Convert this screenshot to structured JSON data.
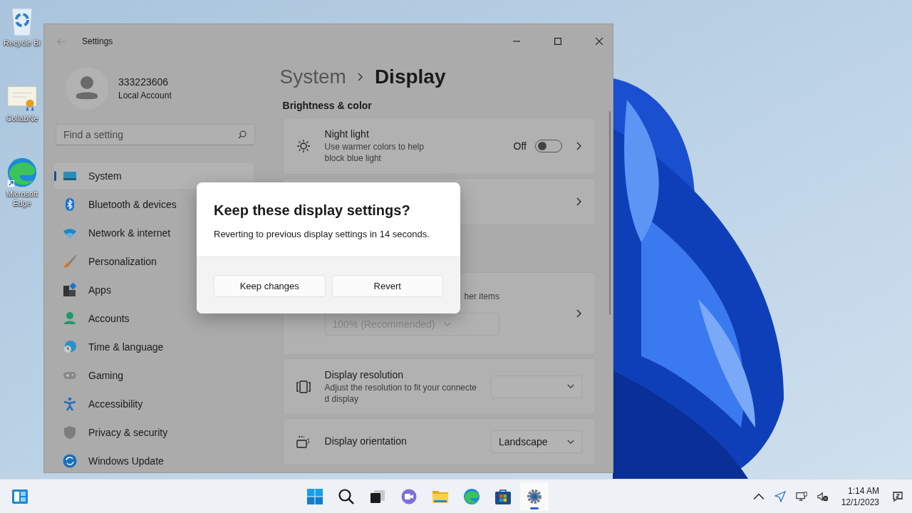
{
  "desktop_icons": [
    {
      "kind": "recycle",
      "label": "Recycle Bi"
    },
    {
      "kind": "certificate",
      "label": "CollabNe"
    },
    {
      "kind": "edge",
      "label": "Microsoft Edge"
    }
  ],
  "window": {
    "title": "Settings"
  },
  "account": {
    "name": "333223606",
    "type": "Local Account"
  },
  "search": {
    "placeholder": "Find a setting"
  },
  "nav": [
    {
      "kind": "system",
      "label": "System",
      "selected": true
    },
    {
      "kind": "bluetooth",
      "label": "Bluetooth & devices",
      "selected": false
    },
    {
      "kind": "network",
      "label": "Network & internet",
      "selected": false
    },
    {
      "kind": "personalization",
      "label": "Personalization",
      "selected": false
    },
    {
      "kind": "apps",
      "label": "Apps",
      "selected": false
    },
    {
      "kind": "accounts",
      "label": "Accounts",
      "selected": false
    },
    {
      "kind": "time",
      "label": "Time & language",
      "selected": false
    },
    {
      "kind": "gaming",
      "label": "Gaming",
      "selected": false
    },
    {
      "kind": "accessibility",
      "label": "Accessibility",
      "selected": false
    },
    {
      "kind": "privacy",
      "label": "Privacy & security",
      "selected": false
    },
    {
      "kind": "update",
      "label": "Windows Update",
      "selected": false
    }
  ],
  "breadcrumb": {
    "parent": "System",
    "current": "Display"
  },
  "section": "Brightness & color",
  "cards": [
    {
      "kind": "toggle",
      "title": "Night light",
      "description_lines": [
        "Use warmer colors to help",
        "block blue light"
      ],
      "state_label": "Off",
      "on": false
    },
    {
      "kind": "link"
    },
    {
      "kind": "scale",
      "description_fragment": "her items",
      "dropdown": "100% (Recommended)",
      "disabled": true
    },
    {
      "kind": "dropdown",
      "title": "Display resolution",
      "description_lines": [
        "Adjust the resolution to fit your connecte",
        "d display"
      ]
    },
    {
      "kind": "dropdown",
      "title": "Display orientation",
      "value": "Landscape"
    }
  ],
  "dialog": {
    "title": "Keep these display settings?",
    "message": "Reverting to previous display settings in 14 seconds.",
    "buttons": [
      "Keep changes",
      "Revert"
    ]
  },
  "taskbar": {
    "apps": [
      {
        "kind": "start",
        "active": false
      },
      {
        "kind": "search",
        "active": false
      },
      {
        "kind": "taskview",
        "active": false
      },
      {
        "kind": "chat",
        "active": false
      },
      {
        "kind": "explorer",
        "active": false
      },
      {
        "kind": "edge",
        "active": false
      },
      {
        "kind": "store",
        "active": false
      },
      {
        "kind": "settings",
        "active": true
      }
    ],
    "time": "1:14 AM",
    "date": "12/1/2023"
  }
}
